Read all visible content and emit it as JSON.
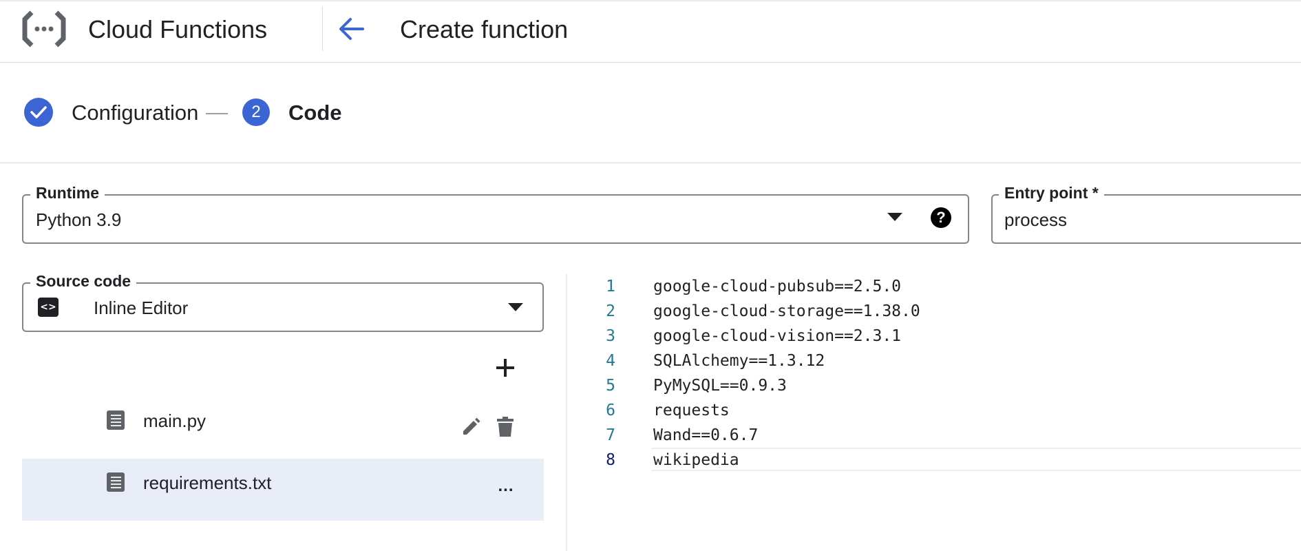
{
  "header": {
    "app_title": "Cloud Functions",
    "page_title": "Create function"
  },
  "stepper": {
    "steps": [
      {
        "label": "Configuration",
        "state": "complete"
      },
      {
        "label": "Code",
        "number": "2",
        "state": "active"
      }
    ]
  },
  "runtime": {
    "label": "Runtime",
    "value": "Python 3.9"
  },
  "entry_point": {
    "label": "Entry point *",
    "value": "process"
  },
  "source_code": {
    "label": "Source code",
    "value": "Inline Editor",
    "icon": "code-icon"
  },
  "files": [
    {
      "name": "main.py",
      "selected": false
    },
    {
      "name": "requirements.txt",
      "selected": true
    }
  ],
  "editor": {
    "lines": [
      {
        "num": "1",
        "text": "google-cloud-pubsub==2.5.0"
      },
      {
        "num": "2",
        "text": "google-cloud-storage==1.38.0"
      },
      {
        "num": "3",
        "text": "google-cloud-vision==2.3.1"
      },
      {
        "num": "4",
        "text": "SQLAlchemy==1.3.12"
      },
      {
        "num": "5",
        "text": "PyMySQL==0.9.3"
      },
      {
        "num": "6",
        "text": "requests"
      },
      {
        "num": "7",
        "text": "Wand==0.6.7"
      },
      {
        "num": "8",
        "text": "wikipedia"
      }
    ],
    "current_line": 8
  },
  "colors": {
    "accent": "#3b64d4",
    "selected_row": "#e8edf7",
    "line_number": "#237893"
  }
}
